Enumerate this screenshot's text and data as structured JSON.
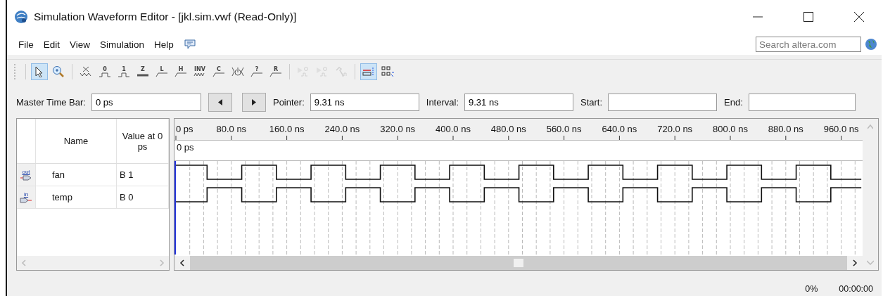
{
  "window": {
    "title": "Simulation Waveform Editor - [jkl.sim.vwf (Read-Only)]"
  },
  "menu": [
    "File",
    "Edit",
    "View",
    "Simulation",
    "Help"
  ],
  "search": {
    "placeholder": "Search altera.com"
  },
  "toolbar": [
    {
      "kind": "pointer",
      "selected": true,
      "disabled": false
    },
    {
      "kind": "zoom",
      "selected": false,
      "disabled": false
    },
    {
      "kind": "separator"
    },
    {
      "kind": "unknown",
      "selected": false,
      "disabled": false
    },
    {
      "kind": "low",
      "glyph": "0",
      "selected": false,
      "disabled": false
    },
    {
      "kind": "high",
      "glyph": "1",
      "selected": false,
      "disabled": false
    },
    {
      "kind": "bar",
      "glyph": "Z",
      "selected": false,
      "disabled": false
    },
    {
      "kind": "bus",
      "glyph": "L",
      "selected": false,
      "disabled": false
    },
    {
      "kind": "bus",
      "glyph": "H",
      "selected": false,
      "disabled": false
    },
    {
      "kind": "wave",
      "glyph": "INV",
      "selected": false,
      "disabled": false
    },
    {
      "kind": "bus",
      "glyph": "C",
      "selected": false,
      "disabled": false
    },
    {
      "kind": "clock",
      "selected": false,
      "disabled": false
    },
    {
      "kind": "bus",
      "glyph": "?",
      "selected": false,
      "disabled": false
    },
    {
      "kind": "bus",
      "glyph": "R",
      "selected": false,
      "disabled": false
    },
    {
      "kind": "separator"
    },
    {
      "kind": "run",
      "selected": false,
      "disabled": true
    },
    {
      "kind": "run",
      "selected": false,
      "disabled": true
    },
    {
      "kind": "hammer",
      "selected": false,
      "disabled": true
    },
    {
      "kind": "separator"
    },
    {
      "kind": "snap",
      "selected": true,
      "disabled": false
    },
    {
      "kind": "grid",
      "selected": false,
      "disabled": false
    }
  ],
  "time_bar": {
    "master_label": "Master Time Bar:",
    "master_value": "0 ps",
    "fields": [
      {
        "label": "Pointer:",
        "value": "9.31 ns"
      },
      {
        "label": "Interval:",
        "value": "9.31 ns"
      },
      {
        "label": "Start:"
      },
      {
        "label": "End:"
      }
    ]
  },
  "signal_list": {
    "columns": [
      "Name",
      "Value at 0 ps"
    ],
    "signals": [
      {
        "kind": "output",
        "pin": "out",
        "name": "fan",
        "value": "B 1"
      },
      {
        "kind": "input",
        "pin": "in",
        "name": "temp",
        "value": "B 0"
      }
    ]
  },
  "waveform": {
    "cursor_label": "0 ps",
    "ruler_labels": [
      "0 ps",
      "80.0 ns",
      "160.0 ns",
      "240.0 ns",
      "320.0 ns",
      "400.0 ns",
      "480.0 ns",
      "560.0 ns",
      "640.0 ns",
      "720.0 ns",
      "800.0 ns",
      "880.0 ns",
      "960.0 ns"
    ]
  },
  "status_bar": {
    "progress": "0%",
    "elapsed": "00:00:00"
  }
}
